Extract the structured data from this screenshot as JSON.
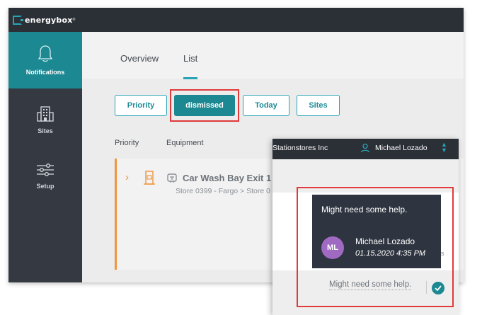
{
  "brand": {
    "name": "energybox",
    "mark": "®"
  },
  "sidebar": {
    "items": [
      {
        "label": "Notifications",
        "icon": "bell-icon",
        "active": true
      },
      {
        "label": "Sites",
        "icon": "building-icon",
        "active": false
      },
      {
        "label": "Setup",
        "icon": "sliders-icon",
        "active": false
      }
    ]
  },
  "tabs": [
    {
      "label": "Overview",
      "active": false
    },
    {
      "label": "List",
      "active": true
    }
  ],
  "filters": [
    {
      "label": "Priority",
      "selected": false
    },
    {
      "label": "dismissed",
      "selected": true
    },
    {
      "label": "Today",
      "selected": false
    },
    {
      "label": "Sites",
      "selected": false
    }
  ],
  "columns": {
    "priority": "Priority",
    "equipment": "Equipment"
  },
  "notification": {
    "title": "Car Wash Bay Exit 1",
    "subtitle": "Store 0399 - Fargo > Store 0",
    "icon": "door-icon",
    "equipment_icon": "equipment-tag-icon"
  },
  "overlay": {
    "org": "Stationstores Inc",
    "user": "Michael Lozado",
    "tooltip": {
      "message": "Might need some help.",
      "initials": "ML",
      "author": "Michael Lozado",
      "date": "01.15.2020 4:35 PM",
      "trail": "s"
    },
    "comment": "Might need some help."
  },
  "colors": {
    "accent": "#1c8892",
    "priority_orange": "#f0953b",
    "highlight_red": "#e03a3a",
    "dark": "#2b2f36",
    "avatar": "#a06ac2"
  }
}
